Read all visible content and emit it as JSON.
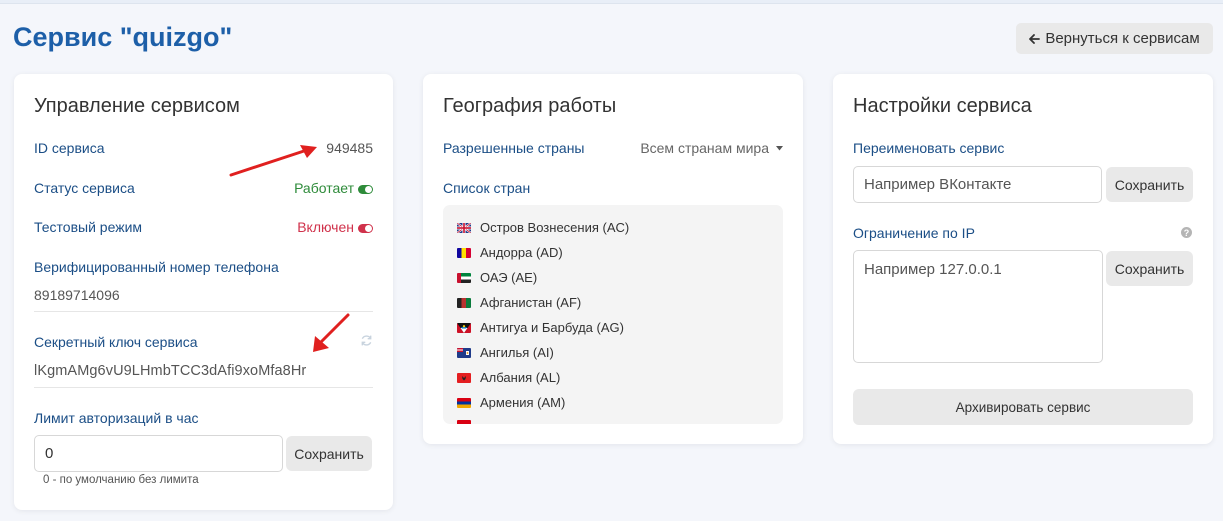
{
  "page": {
    "title": "Сервис \"quizgo\""
  },
  "header": {
    "back_label": "Вернуться к сервисам",
    "back_icon": "arrow-left-icon"
  },
  "management": {
    "title": "Управление сервисом",
    "service_id_label": "ID сервиса",
    "service_id_value": "949485",
    "status_label": "Статус сервиса",
    "status_value": "Работает",
    "test_mode_label": "Тестовый режим",
    "test_mode_value": "Включен",
    "phone_label": "Верифицированный номер телефона",
    "phone_value": "89189714096",
    "secret_label": "Секретный ключ сервиса",
    "secret_value": "lKgmAMg6vU9LHmbTCC3dAfi9xoMfa8Hr",
    "limit_label": "Лимит авторизаций в час",
    "limit_value": "0",
    "limit_save": "Сохранить",
    "limit_hint": "0 - по умолчанию без лимита",
    "colors": {
      "status_on": "#2e8b3a",
      "test_on": "#d0324b"
    }
  },
  "geo": {
    "title": "География работы",
    "allowed_label": "Разрешенные страны",
    "allowed_value": "Всем странам мира",
    "list_label": "Список стран",
    "countries": [
      {
        "name": "Остров Вознесения (AC)",
        "flag": "gb"
      },
      {
        "name": "Андорра (AD)",
        "flag": "ad"
      },
      {
        "name": "ОАЭ (AE)",
        "flag": "ae"
      },
      {
        "name": "Афганистан (AF)",
        "flag": "af"
      },
      {
        "name": "Антигуа и Барбуда (AG)",
        "flag": "ag"
      },
      {
        "name": "Ангилья (AI)",
        "flag": "ai"
      },
      {
        "name": "Албания (AL)",
        "flag": "al"
      },
      {
        "name": "Армения (AM)",
        "flag": "am"
      }
    ]
  },
  "settings": {
    "title": "Настройки сервиса",
    "rename_label": "Переименовать сервис",
    "rename_placeholder": "Например ВКонтакте",
    "rename_save": "Сохранить",
    "ip_label": "Ограничение по IP",
    "ip_placeholder": "Например 127.0.0.1",
    "ip_save": "Сохранить",
    "archive_label": "Архивировать сервис"
  }
}
